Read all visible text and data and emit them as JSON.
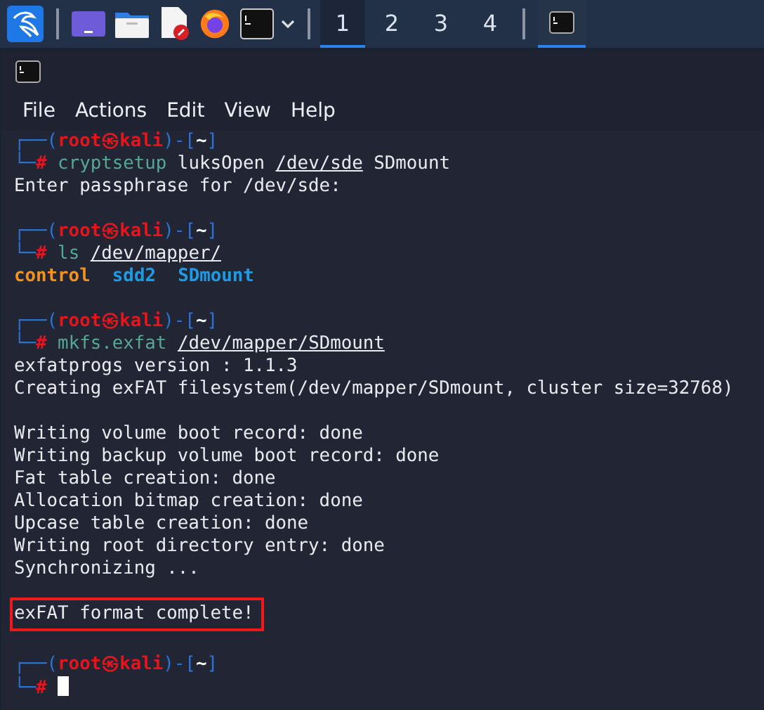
{
  "taskbar": {
    "workspaces": [
      {
        "label": "1",
        "selected": true
      },
      {
        "label": "2",
        "selected": false
      },
      {
        "label": "3",
        "selected": false
      },
      {
        "label": "4",
        "selected": false
      }
    ],
    "tasks": [
      {
        "selected": true
      }
    ]
  },
  "menu": [
    "File",
    "Actions",
    "Edit",
    "View",
    "Help"
  ],
  "terminal": {
    "lines": [
      {
        "kind": "prompt",
        "segments": [
          {
            "kind": "frame",
            "text": "┌──("
          },
          {
            "kind": "user",
            "text": "root㉿kali"
          },
          {
            "kind": "frame",
            "text": ")-["
          },
          {
            "kind": "dir",
            "text": "~"
          },
          {
            "kind": "frame",
            "text": "]"
          }
        ]
      },
      {
        "kind": "prompt",
        "segments": [
          {
            "kind": "frame",
            "text": "└─"
          },
          {
            "kind": "user",
            "text": "#"
          },
          {
            "kind": "cmd",
            "text": " cryptsetup"
          },
          {
            "kind": "arg",
            "text": " luksOpen "
          },
          {
            "kind": "path",
            "text": "/dev/sde"
          },
          {
            "kind": "arg",
            "text": " SDmount"
          }
        ]
      },
      {
        "kind": "output",
        "text": "Enter passphrase for /dev/sde:"
      },
      {
        "kind": "blank"
      },
      {
        "kind": "prompt",
        "segments": [
          {
            "kind": "frame",
            "text": "┌──("
          },
          {
            "kind": "user",
            "text": "root㉿kali"
          },
          {
            "kind": "frame",
            "text": ")-["
          },
          {
            "kind": "dir",
            "text": "~"
          },
          {
            "kind": "frame",
            "text": "]"
          }
        ]
      },
      {
        "kind": "prompt",
        "segments": [
          {
            "kind": "frame",
            "text": "└─"
          },
          {
            "kind": "user",
            "text": "#"
          },
          {
            "kind": "cmd",
            "text": " ls "
          },
          {
            "kind": "path",
            "text": "/dev/mapper/"
          }
        ]
      },
      {
        "kind": "listing",
        "entries": [
          {
            "text": "control",
            "color": "#f5921e"
          },
          {
            "text": "sdd2",
            "color": "#1c9be6"
          },
          {
            "text": "SDmount",
            "color": "#1c9be6"
          }
        ]
      },
      {
        "kind": "blank"
      },
      {
        "kind": "prompt",
        "segments": [
          {
            "kind": "frame",
            "text": "┌──("
          },
          {
            "kind": "user",
            "text": "root㉿kali"
          },
          {
            "kind": "frame",
            "text": ")-["
          },
          {
            "kind": "dir",
            "text": "~"
          },
          {
            "kind": "frame",
            "text": "]"
          }
        ]
      },
      {
        "kind": "prompt",
        "segments": [
          {
            "kind": "frame",
            "text": "└─"
          },
          {
            "kind": "user",
            "text": "#"
          },
          {
            "kind": "cmd",
            "text": " mkfs.exfat "
          },
          {
            "kind": "path",
            "text": "/dev/mapper/SDmount"
          }
        ]
      },
      {
        "kind": "output",
        "text": "exfatprogs version : 1.1.3"
      },
      {
        "kind": "output",
        "text": "Creating exFAT filesystem(/dev/mapper/SDmount, cluster size=32768)"
      },
      {
        "kind": "blank"
      },
      {
        "kind": "output",
        "text": "Writing volume boot record: done"
      },
      {
        "kind": "output",
        "text": "Writing backup volume boot record: done"
      },
      {
        "kind": "output",
        "text": "Fat table creation: done"
      },
      {
        "kind": "output",
        "text": "Allocation bitmap creation: done"
      },
      {
        "kind": "output",
        "text": "Upcase table creation: done"
      },
      {
        "kind": "output",
        "text": "Writing root directory entry: done"
      },
      {
        "kind": "output",
        "text": "Synchronizing ..."
      },
      {
        "kind": "blank"
      },
      {
        "kind": "highlight",
        "text": "exFAT format complete!"
      },
      {
        "kind": "blank"
      },
      {
        "kind": "prompt",
        "segments": [
          {
            "kind": "frame",
            "text": "┌──("
          },
          {
            "kind": "user",
            "text": "root㉿kali"
          },
          {
            "kind": "frame",
            "text": ")-["
          },
          {
            "kind": "dir",
            "text": "~"
          },
          {
            "kind": "frame",
            "text": "]"
          }
        ]
      },
      {
        "kind": "prompt",
        "cursor": true,
        "segments": [
          {
            "kind": "frame",
            "text": "└─"
          },
          {
            "kind": "user",
            "text": "#"
          }
        ]
      }
    ]
  }
}
